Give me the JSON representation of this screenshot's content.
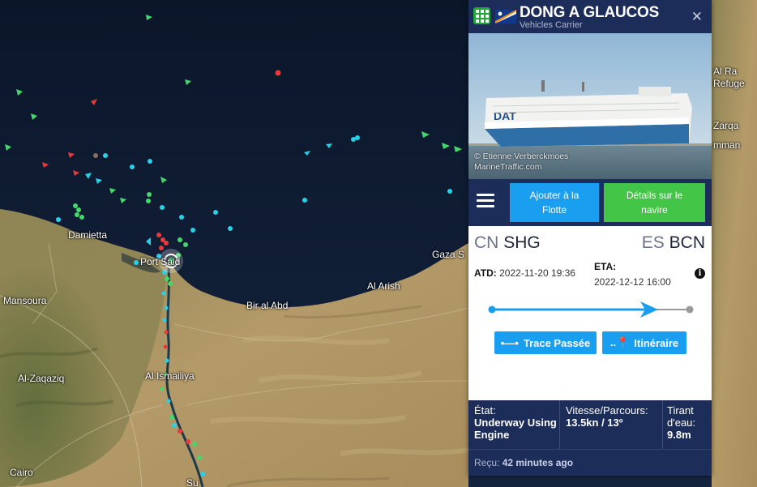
{
  "map": {
    "places": [
      {
        "id": "damietta",
        "label": "Damietta"
      },
      {
        "id": "port-said",
        "label": "Port Said"
      },
      {
        "id": "mansoura",
        "label": "Mansoura"
      },
      {
        "id": "al-arish",
        "label": "Al Arish"
      },
      {
        "id": "bir-al-abd",
        "label": "Bir al Abd"
      },
      {
        "id": "gaza",
        "label": "Gaza S"
      },
      {
        "id": "al-zaqaziq",
        "label": "Al-Zaqaziq"
      },
      {
        "id": "al-ismailiya",
        "label": "Al Ismailiya"
      },
      {
        "id": "cairo",
        "label": "Cairo"
      },
      {
        "id": "al-ra",
        "label": "Al Ra"
      },
      {
        "id": "refugee",
        "label": "Refuge"
      },
      {
        "id": "zarqa",
        "label": "Zarqa"
      },
      {
        "id": "amman",
        "label": "mman"
      },
      {
        "id": "su",
        "label": "Su"
      }
    ]
  },
  "panel": {
    "name": "DONG A GLAUCOS",
    "type": "Vehicles Carrier",
    "photo_credit_line1": "© Etienne Verberckmoes",
    "photo_credit_line2": "MarineTraffic.com",
    "hull_text": "DAT",
    "buttons": {
      "add_fleet": "Ajouter à la Flotte",
      "details": "Détails sur le navire",
      "trace": "Trace Passée",
      "itinerary": "Itinéraire"
    },
    "route": {
      "dep_country": "CN",
      "dep_port": "SHG",
      "arr_country": "ES",
      "arr_port": "BCN",
      "atd_label": "ATD:",
      "atd_value": "2022-11-20 19:36",
      "eta_label": "ETA:",
      "eta_value": "2022-12-12 16:00",
      "progress": 0.84
    },
    "status": {
      "state_label": "État:",
      "state_value": "Underway Using Engine",
      "speed_label": "Vitesse/Parcours:",
      "speed_value": "13.5kn / 13º",
      "draught_label": "Tirant d'eau:",
      "draught_value": "9.8m"
    },
    "received_label": "Reçu:",
    "received_value": "42 minutes ago"
  },
  "colors": {
    "panel_navy": "#1d2d59",
    "button_blue": "#1a9ff0",
    "button_green": "#43c547",
    "sea": "#0d1a33",
    "land": "#a08a5a",
    "vessel_cargo": "#44d86b",
    "vessel_tanker": "#e83a3a",
    "vessel_passenger": "#29d1e8"
  }
}
